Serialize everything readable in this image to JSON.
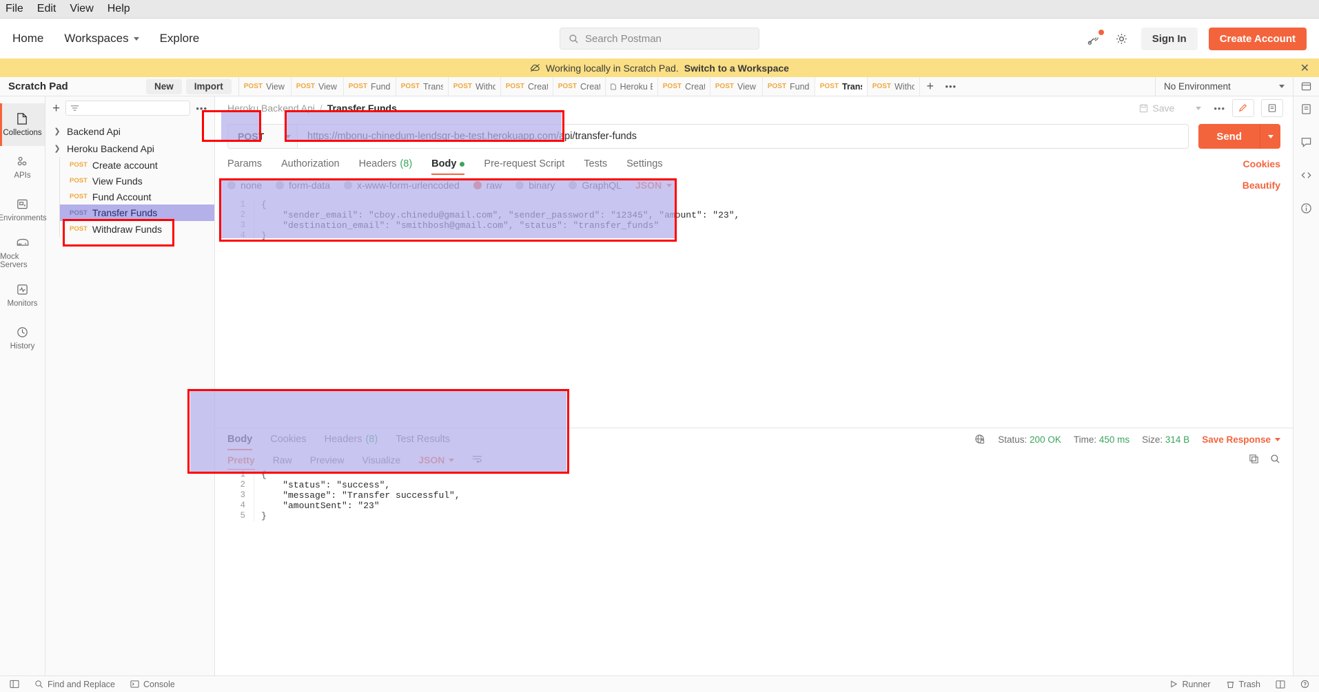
{
  "os_menu": [
    "File",
    "Edit",
    "View",
    "Help"
  ],
  "topnav": {
    "home": "Home",
    "workspaces": "Workspaces",
    "explore": "Explore",
    "search_placeholder": "Search Postman",
    "sign_in": "Sign In",
    "create_account": "Create Account"
  },
  "banner": {
    "text": "Working locally in Scratch Pad.",
    "link": "Switch to a Workspace"
  },
  "workspace": {
    "title": "Scratch Pad",
    "new_button": "New",
    "import_button": "Import",
    "environment": "No Environment"
  },
  "tabs": [
    {
      "method": "POST",
      "name": "View Ch"
    },
    {
      "method": "POST",
      "name": "View Sm"
    },
    {
      "method": "POST",
      "name": "Fund Sm"
    },
    {
      "method": "POST",
      "name": "Transfer"
    },
    {
      "method": "POST",
      "name": "Withdraw"
    },
    {
      "method": "POST",
      "name": "Create a"
    },
    {
      "method": "POST",
      "name": "Create a"
    },
    {
      "method": "",
      "name": "Heroku Ba"
    },
    {
      "method": "POST",
      "name": "Create a"
    },
    {
      "method": "POST",
      "name": "View Fun"
    },
    {
      "method": "POST",
      "name": "Fund Acc"
    },
    {
      "method": "POST",
      "name": "Transfer"
    },
    {
      "method": "POST",
      "name": "Withdraw"
    }
  ],
  "active_tab_index": 11,
  "rail": [
    {
      "label": "Collections",
      "icon": "collections-icon"
    },
    {
      "label": "APIs",
      "icon": "apis-icon"
    },
    {
      "label": "Environments",
      "icon": "environments-icon"
    },
    {
      "label": "Mock Servers",
      "icon": "mock-servers-icon"
    },
    {
      "label": "Monitors",
      "icon": "monitors-icon"
    },
    {
      "label": "History",
      "icon": "history-icon"
    }
  ],
  "collections": {
    "roots": [
      {
        "name": "Backend Api",
        "expanded": false,
        "items": []
      },
      {
        "name": "Heroku Backend Api",
        "expanded": true,
        "items": [
          {
            "method": "POST",
            "name": "Create account"
          },
          {
            "method": "POST",
            "name": "View Funds"
          },
          {
            "method": "POST",
            "name": "Fund Account"
          },
          {
            "method": "POST",
            "name": "Transfer Funds"
          },
          {
            "method": "POST",
            "name": "Withdraw Funds"
          }
        ]
      }
    ]
  },
  "request": {
    "breadcrumb_parent": "Heroku Backend Api",
    "breadcrumb_sep": "/",
    "breadcrumb_current": "Transfer Funds",
    "save_label": "Save",
    "method": "POST",
    "url": "https://mbonu-chinedum-lendsqr-be-test.herokuapp.com/api/transfer-funds",
    "send_label": "Send",
    "tabs": [
      {
        "label": "Params",
        "count": "",
        "dot": false
      },
      {
        "label": "Authorization",
        "count": "",
        "dot": false
      },
      {
        "label": "Headers",
        "count": "(8)",
        "dot": false
      },
      {
        "label": "Body",
        "count": "",
        "dot": true
      },
      {
        "label": "Pre-request Script",
        "count": "",
        "dot": false
      },
      {
        "label": "Tests",
        "count": "",
        "dot": false
      },
      {
        "label": "Settings",
        "count": "",
        "dot": false
      }
    ],
    "active_tab": "Body",
    "cookies_link": "Cookies",
    "body_types": [
      "none",
      "form-data",
      "x-www-form-urlencoded",
      "raw",
      "binary",
      "GraphQL"
    ],
    "body_type_selected": "raw",
    "body_format": "JSON",
    "beautify": "Beautify",
    "body_lines": [
      "{",
      "    \"sender_email\": \"cboy.chinedu@gmail.com\", \"sender_password\": \"12345\", \"amount\": \"23\",",
      "    \"destination_email\": \"smithbosh@gmail.com\", \"status\": \"transfer_funds\"",
      "}"
    ]
  },
  "response": {
    "tabs": [
      {
        "label": "Body",
        "count": ""
      },
      {
        "label": "Cookies",
        "count": ""
      },
      {
        "label": "Headers",
        "count": "(8)"
      },
      {
        "label": "Test Results",
        "count": ""
      }
    ],
    "active_tab": "Body",
    "status_label": "Status:",
    "status_value": "200 OK",
    "time_label": "Time:",
    "time_value": "450 ms",
    "size_label": "Size:",
    "size_value": "314 B",
    "save_response": "Save Response",
    "views": [
      "Pretty",
      "Raw",
      "Preview",
      "Visualize"
    ],
    "active_view": "Pretty",
    "format": "JSON",
    "body_lines": [
      "{",
      "    \"status\": \"success\",",
      "    \"message\": \"Transfer successful\",",
      "    \"amountSent\": \"23\"",
      "}"
    ]
  },
  "statusbar": {
    "find_replace": "Find and Replace",
    "console": "Console",
    "runner": "Runner",
    "trash": "Trash"
  },
  "colors": {
    "accent": "#f4643c",
    "method": "#f0a83c",
    "success": "#3aa55c",
    "banner": "#fadf85",
    "highlight": "#b3b0ea",
    "annotation": "#ff0000"
  }
}
